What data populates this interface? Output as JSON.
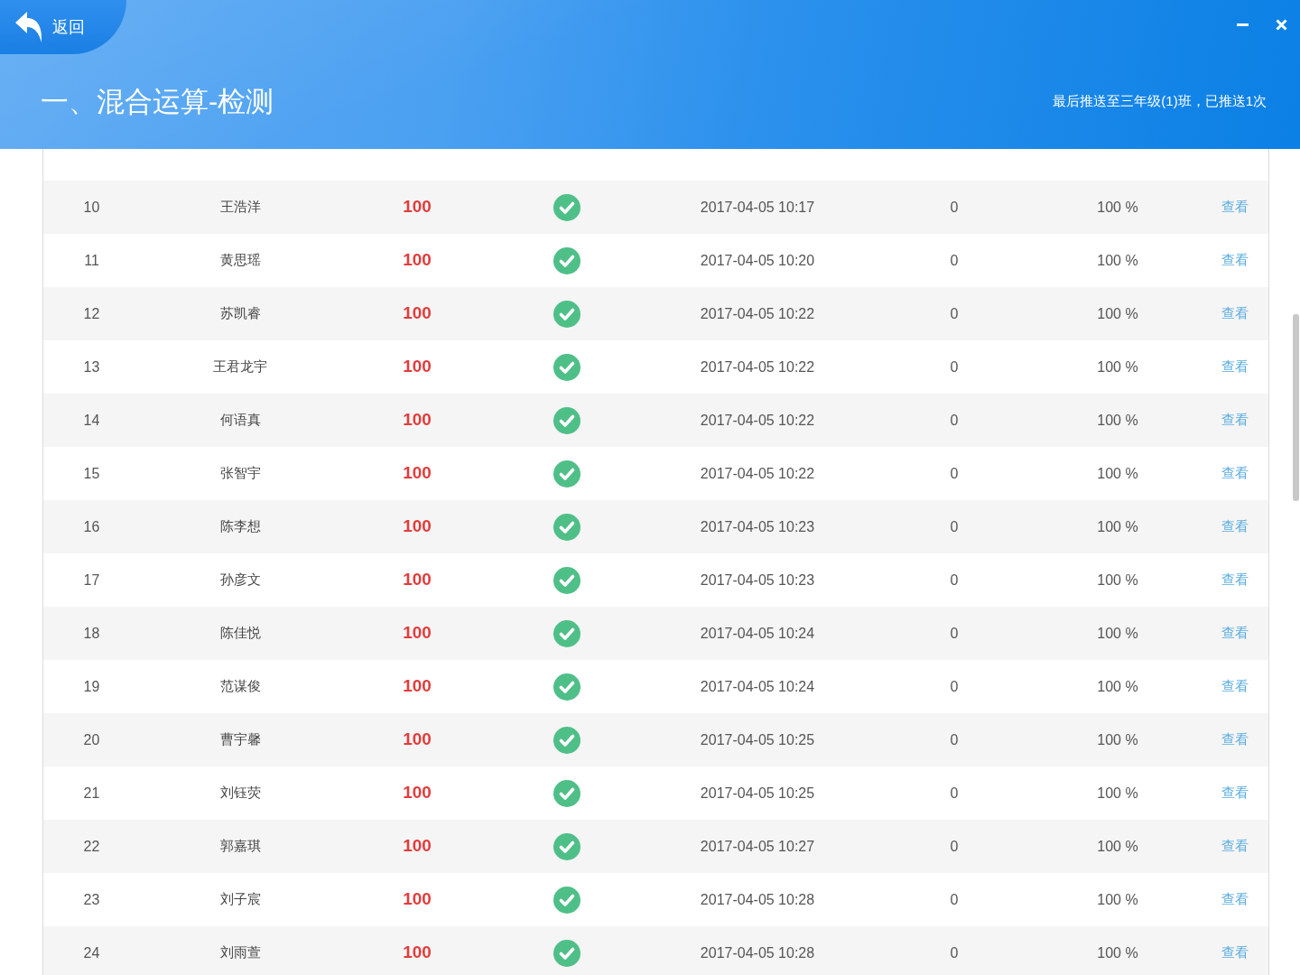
{
  "header": {
    "back_label": "返回",
    "title": "一、混合运算-检测",
    "push_status": "最后推送至三年级(1)班，已推送1次"
  },
  "table": {
    "rows": [
      {
        "index": "10",
        "name": "王浩洋",
        "score": "100",
        "passed": true,
        "time": "2017-04-05 10:17",
        "column_6": "0",
        "column_7": "100 %",
        "link": "查看"
      },
      {
        "index": "11",
        "name": "黄思瑶",
        "score": "100",
        "passed": true,
        "time": "2017-04-05 10:20",
        "column_6": "0",
        "column_7": "100 %",
        "link": "查看"
      },
      {
        "index": "12",
        "name": "苏凯睿",
        "score": "100",
        "passed": true,
        "time": "2017-04-05 10:22",
        "column_6": "0",
        "column_7": "100 %",
        "link": "查看"
      },
      {
        "index": "13",
        "name": "王君龙宇",
        "score": "100",
        "passed": true,
        "time": "2017-04-05 10:22",
        "column_6": "0",
        "column_7": "100 %",
        "link": "查看"
      },
      {
        "index": "14",
        "name": "何语真",
        "score": "100",
        "passed": true,
        "time": "2017-04-05 10:22",
        "column_6": "0",
        "column_7": "100 %",
        "link": "查看"
      },
      {
        "index": "15",
        "name": "张智宇",
        "score": "100",
        "passed": true,
        "time": "2017-04-05 10:22",
        "column_6": "0",
        "column_7": "100 %",
        "link": "查看"
      },
      {
        "index": "16",
        "name": "陈李想",
        "score": "100",
        "passed": true,
        "time": "2017-04-05 10:23",
        "column_6": "0",
        "column_7": "100 %",
        "link": "查看"
      },
      {
        "index": "17",
        "name": "孙彦文",
        "score": "100",
        "passed": true,
        "time": "2017-04-05 10:23",
        "column_6": "0",
        "column_7": "100 %",
        "link": "查看"
      },
      {
        "index": "18",
        "name": "陈佳悦",
        "score": "100",
        "passed": true,
        "time": "2017-04-05 10:24",
        "column_6": "0",
        "column_7": "100 %",
        "link": "查看"
      },
      {
        "index": "19",
        "name": "范谋俊",
        "score": "100",
        "passed": true,
        "time": "2017-04-05 10:24",
        "column_6": "0",
        "column_7": "100 %",
        "link": "查看"
      },
      {
        "index": "20",
        "name": "曹宇馨",
        "score": "100",
        "passed": true,
        "time": "2017-04-05 10:25",
        "column_6": "0",
        "column_7": "100 %",
        "link": "查看"
      },
      {
        "index": "21",
        "name": "刘钰荧",
        "score": "100",
        "passed": true,
        "time": "2017-04-05 10:25",
        "column_6": "0",
        "column_7": "100 %",
        "link": "查看"
      },
      {
        "index": "22",
        "name": "郭嘉琪",
        "score": "100",
        "passed": true,
        "time": "2017-04-05 10:27",
        "column_6": "0",
        "column_7": "100 %",
        "link": "查看"
      },
      {
        "index": "23",
        "name": "刘子宸",
        "score": "100",
        "passed": true,
        "time": "2017-04-05 10:28",
        "column_6": "0",
        "column_7": "100 %",
        "link": "查看"
      },
      {
        "index": "24",
        "name": "刘雨萱",
        "score": "100",
        "passed": true,
        "time": "2017-04-05 10:28",
        "column_6": "0",
        "column_7": "100 %",
        "link": "查看"
      }
    ]
  }
}
